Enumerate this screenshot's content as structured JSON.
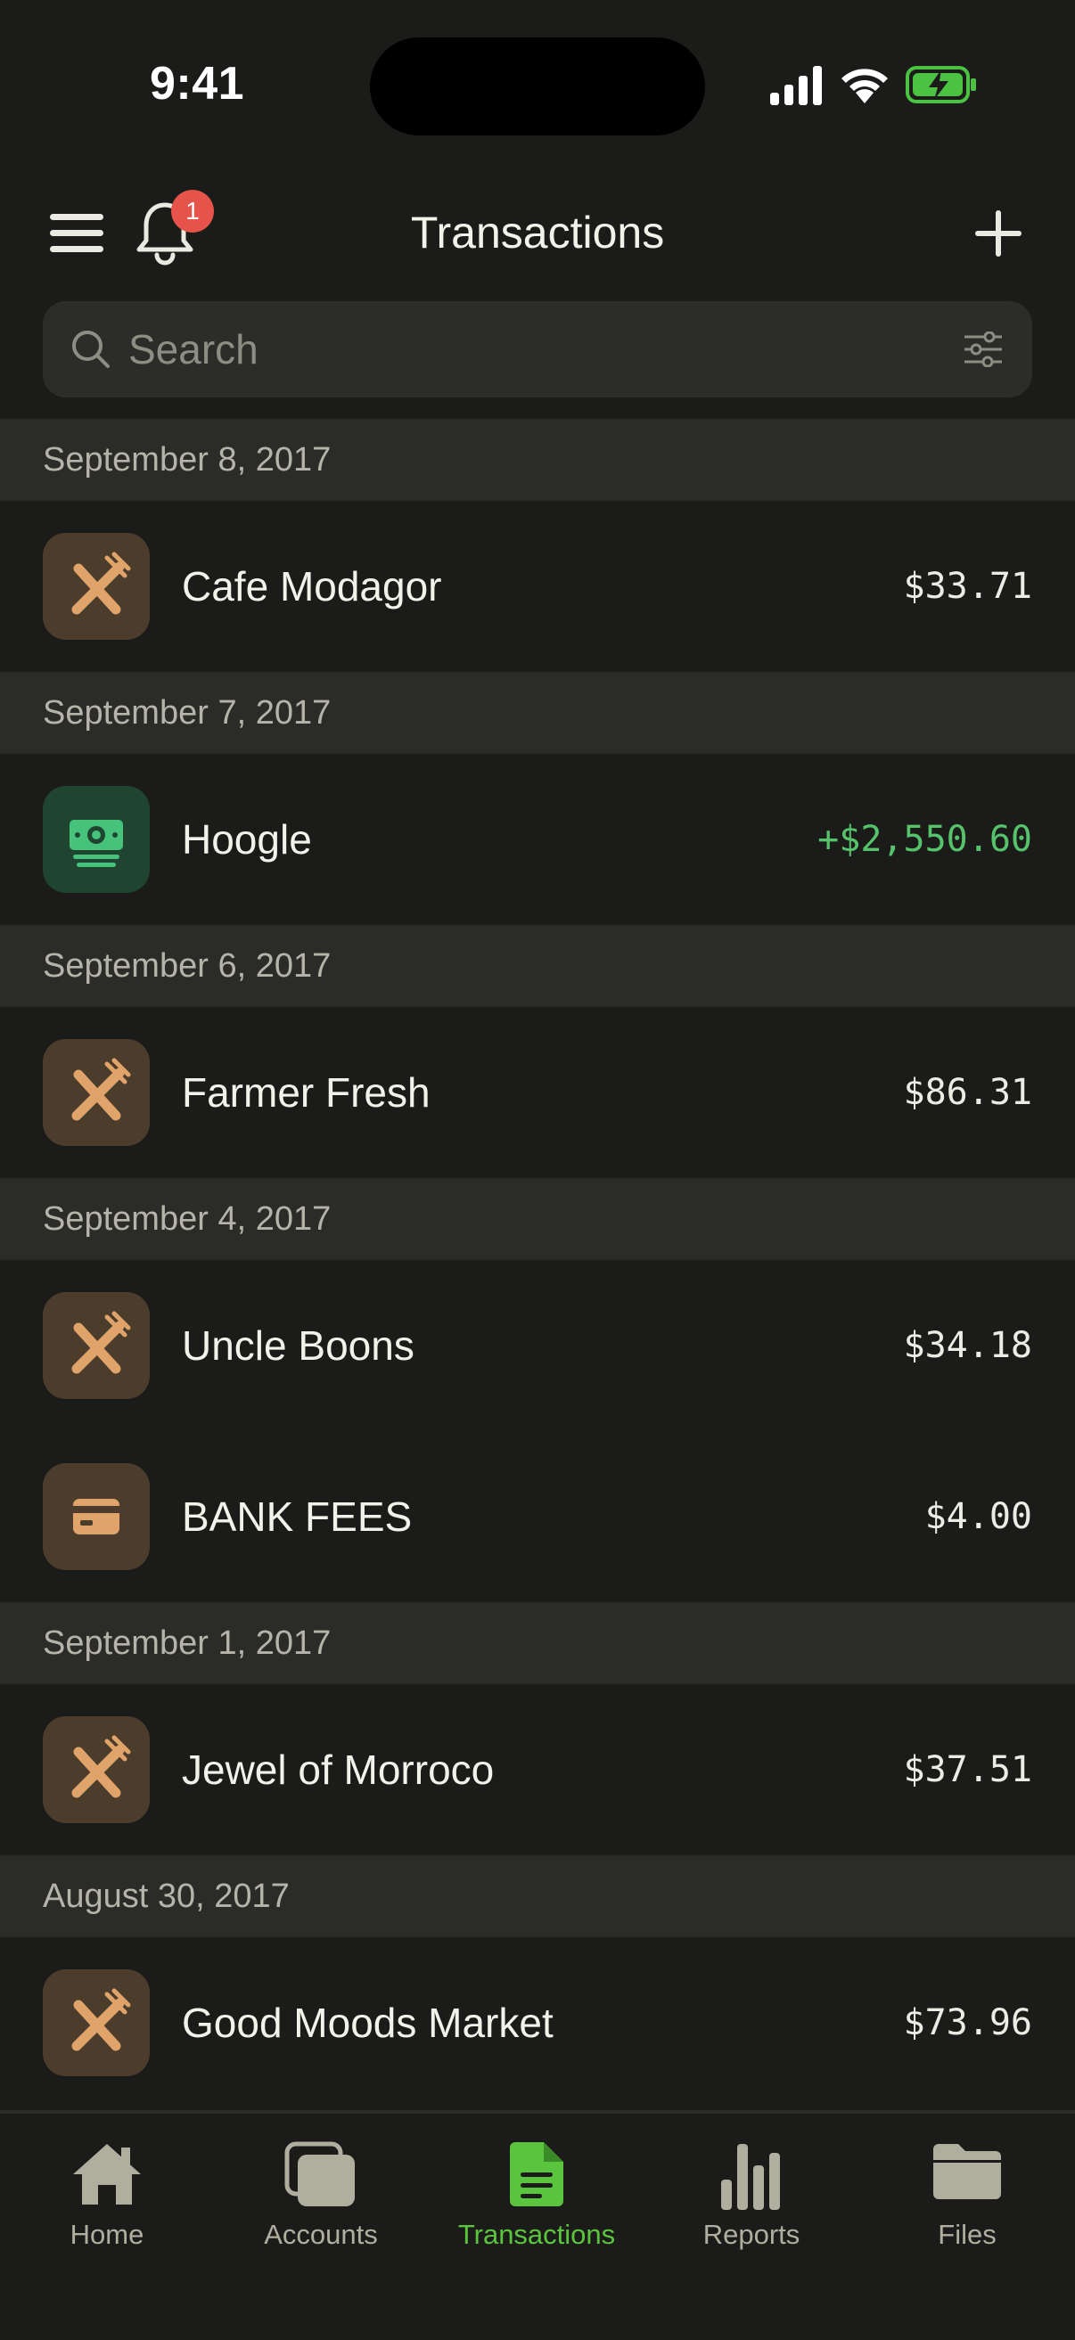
{
  "status_bar": {
    "time": "9:41"
  },
  "header": {
    "title": "Transactions",
    "notification_count": "1"
  },
  "search": {
    "placeholder": "Search"
  },
  "groups": [
    {
      "date": "September 8, 2017",
      "items": [
        {
          "merchant": "Cafe Modagor",
          "amount": "$33.71",
          "icon": "fork-knife-icon"
        }
      ]
    },
    {
      "date": "September 7, 2017",
      "items": [
        {
          "merchant": "Hoogle",
          "amount": "+$2,550.60",
          "icon": "money-icon"
        }
      ]
    },
    {
      "date": "September 6, 2017",
      "items": [
        {
          "merchant": "Farmer Fresh",
          "amount": "$86.31",
          "icon": "fork-knife-icon"
        }
      ]
    },
    {
      "date": "September 4, 2017",
      "items": [
        {
          "merchant": "Uncle Boons",
          "amount": "$34.18",
          "icon": "fork-knife-icon"
        },
        {
          "merchant": "BANK FEES",
          "amount": "$4.00",
          "icon": "credit-card-icon"
        }
      ]
    },
    {
      "date": "September 1, 2017",
      "items": [
        {
          "merchant": "Jewel of Morroco",
          "amount": "$37.51",
          "icon": "fork-knife-icon"
        }
      ]
    },
    {
      "date": "August 30, 2017",
      "items": [
        {
          "merchant": "Good Moods Market",
          "amount": "$73.96",
          "icon": "fork-knife-icon"
        }
      ]
    }
  ],
  "tabs": [
    {
      "label": "Home",
      "icon": "home-icon"
    },
    {
      "label": "Accounts",
      "icon": "accounts-icon"
    },
    {
      "label": "Transactions",
      "icon": "document-icon",
      "active": true
    },
    {
      "label": "Reports",
      "icon": "bar-chart-icon"
    },
    {
      "label": "Files",
      "icon": "folder-icon"
    }
  ],
  "colors": {
    "background": "#1b1c19",
    "section_header": "#2b2c27",
    "accent_green": "#5bc43f",
    "income_green": "#56c26b",
    "expense_tile": "#4b3c2b",
    "income_tile": "#1f4531",
    "badge_red": "#e5534b"
  }
}
